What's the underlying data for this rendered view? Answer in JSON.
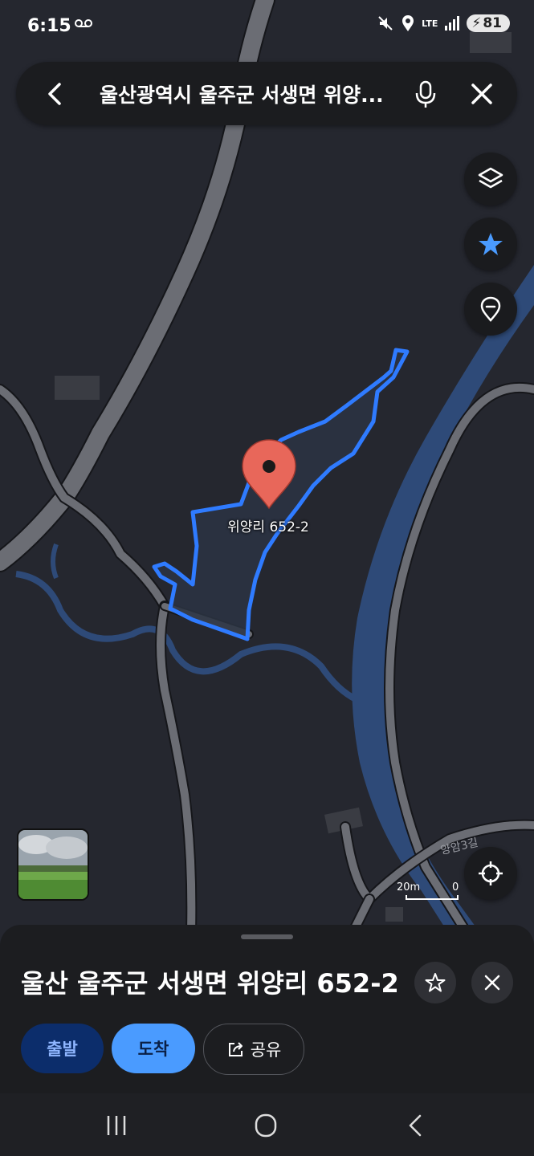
{
  "status_bar": {
    "time": "6:15",
    "network": "LTE",
    "battery": "81"
  },
  "search": {
    "query": "울산광역시 울주군 서생면 위양..."
  },
  "map": {
    "pin_label": "위양리 652-2",
    "street_label": "양암3길",
    "scale_label": "20m",
    "scale_zero": "0",
    "colors": {
      "background": "#25272f",
      "road": "#6b6d74",
      "road_edge": "#15161a",
      "water": "#2e4a78",
      "parcel_outline": "#2f7bff",
      "parcel_fill": "#2c3443",
      "pin": "#e8675a"
    }
  },
  "controls": {
    "layers": "layers-icon",
    "favorites": "star-icon",
    "place": "location-pin-icon",
    "locate": "crosshair-icon"
  },
  "place_sheet": {
    "title": "울산 울주군 서생면 위양리 652-2",
    "depart_label": "출발",
    "arrive_label": "도착",
    "share_label": "공유"
  }
}
